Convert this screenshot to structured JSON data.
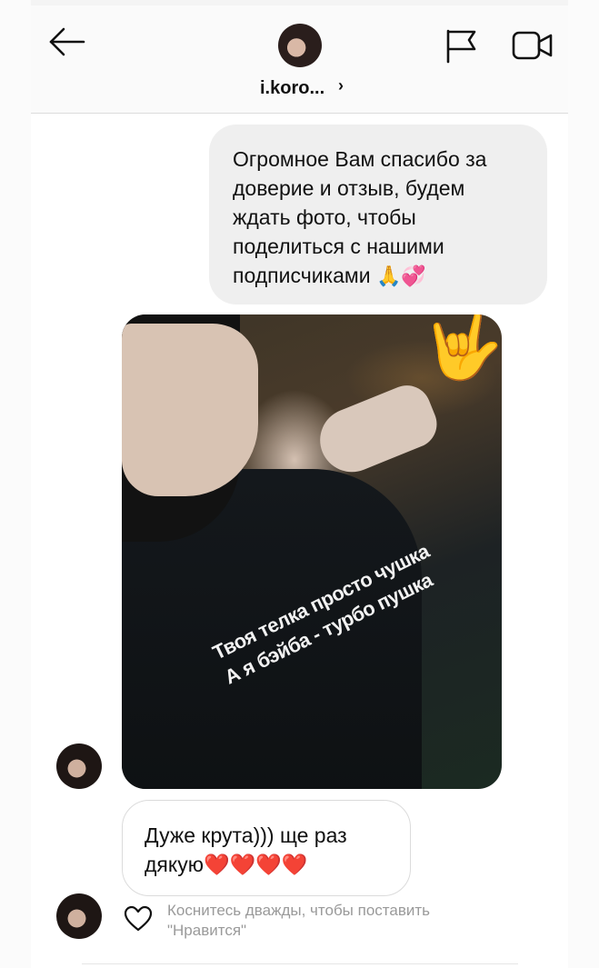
{
  "header": {
    "username": "i.koro...",
    "chevron": "›",
    "icons": [
      "back-arrow-icon",
      "flag-icon",
      "video-camera-icon"
    ]
  },
  "messages": {
    "outgoing_text": "Огромное Вам спасибо за доверие и отзыв, будем ждать фото, чтобы поделиться с нашими подписчиками",
    "outgoing_emoji": "🙏💞",
    "photo_sticker": "🤟",
    "photo_shirt_line_1": "Твоя телка просто чушка",
    "photo_shirt_line_2": "А я бэйба - турбо пушка",
    "incoming_text": "Дуже крута))) ще раз дякую",
    "incoming_emoji": "❤️❤️❤️❤️"
  },
  "footer": {
    "like_hint": "Коснитесь дважды, чтобы поставить \"Нравится\""
  },
  "colors": {
    "outgoing_bubble": "#efefef",
    "incoming_border": "#dbdbdb",
    "hint_text": "#9a9a9a"
  }
}
